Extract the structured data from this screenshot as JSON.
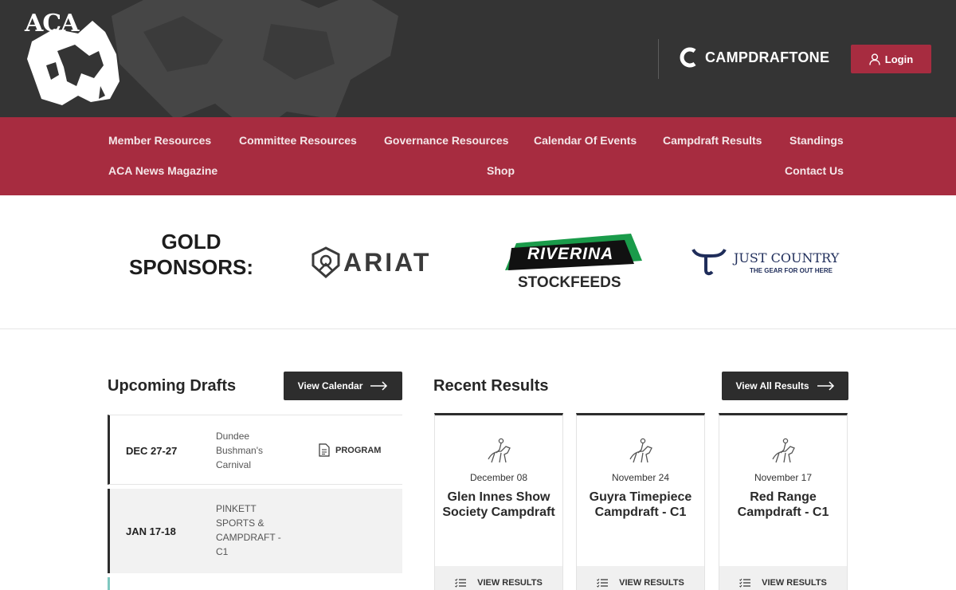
{
  "header": {
    "logo_text": "ACA",
    "campdraftone_label": "CAMPDRAFTONE",
    "login_label": "Login"
  },
  "nav": {
    "items": [
      "Member Resources",
      "Committee Resources",
      "Governance Resources",
      "Calendar Of Events",
      "Campdraft Results",
      "Standings",
      "ACA News Magazine",
      "Shop",
      "Contact Us"
    ]
  },
  "sponsors": {
    "title_line1": "GOLD",
    "title_line2": "SPONSORS:",
    "ariat": "ARIAT",
    "riverina_top": "RIVERINA",
    "riverina_bottom": "STOCKFEEDS",
    "justcountry": "JUST COUNTRY",
    "justcountry_tag": "THE GEAR FOR OUT HERE"
  },
  "drafts": {
    "title": "Upcoming Drafts",
    "button_label": "View Calendar",
    "rows": [
      {
        "date": "DEC 27-27",
        "name": "Dundee Bushman's Carnival",
        "action": "PROGRAM"
      },
      {
        "date": "JAN 17-18",
        "name": "PINKETT SPORTS & CAMPDRAFT - C1",
        "action": ""
      }
    ]
  },
  "results": {
    "title": "Recent Results",
    "button_label": "View All Results",
    "cards": [
      {
        "date": "December 08",
        "title": "Glen Innes Show Society Campdraft",
        "action": "VIEW RESULTS"
      },
      {
        "date": "November 24",
        "title": "Guyra Timepiece Campdraft - C1",
        "action": "VIEW RESULTS"
      },
      {
        "date": "November 17",
        "title": "Red Range Campdraft - C1",
        "action": "VIEW RESULTS"
      }
    ]
  },
  "colors": {
    "header_bg": "#343434",
    "brand_red": "#a72c40",
    "dark_button": "#2d2d2d",
    "riverina_green": "#1a9b4a",
    "justcountry_navy": "#1f2d5a"
  }
}
